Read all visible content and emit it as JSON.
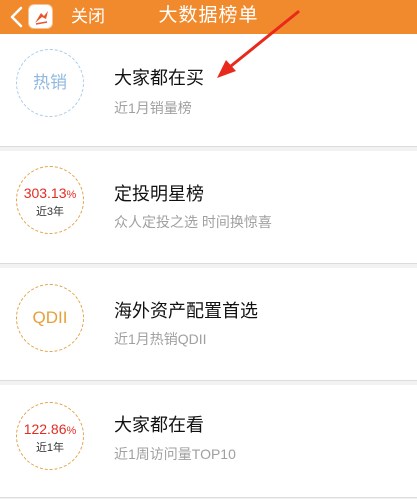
{
  "nav": {
    "close_label": "关闭",
    "title": "大数据榜单",
    "back_icon": "chevron-left-icon",
    "logo_icon": "app-logo-icon",
    "background_color": "#f08a2c"
  },
  "items": [
    {
      "badge": "热销",
      "badge_value": "",
      "badge_unit": "",
      "badge_sub": "",
      "title": "大家都在买",
      "desc": "近1月销量榜"
    },
    {
      "badge": "",
      "badge_value": "303.13",
      "badge_unit": "%",
      "badge_sub": "近3年",
      "title": "定投明星榜",
      "desc": "众人定投之选 时间换惊喜"
    },
    {
      "badge": "QDII",
      "badge_value": "",
      "badge_unit": "",
      "badge_sub": "",
      "title": "海外资产配置首选",
      "desc": "近1月热销QDII"
    },
    {
      "badge": "",
      "badge_value": "122.86",
      "badge_unit": "%",
      "badge_sub": "近1年",
      "title": "大家都在看",
      "desc": "近1周访问量TOP10"
    }
  ],
  "colors": {
    "accent": "#f08a2c",
    "return_red": "#e22c22",
    "annotation_arrow": "#e8291c"
  }
}
